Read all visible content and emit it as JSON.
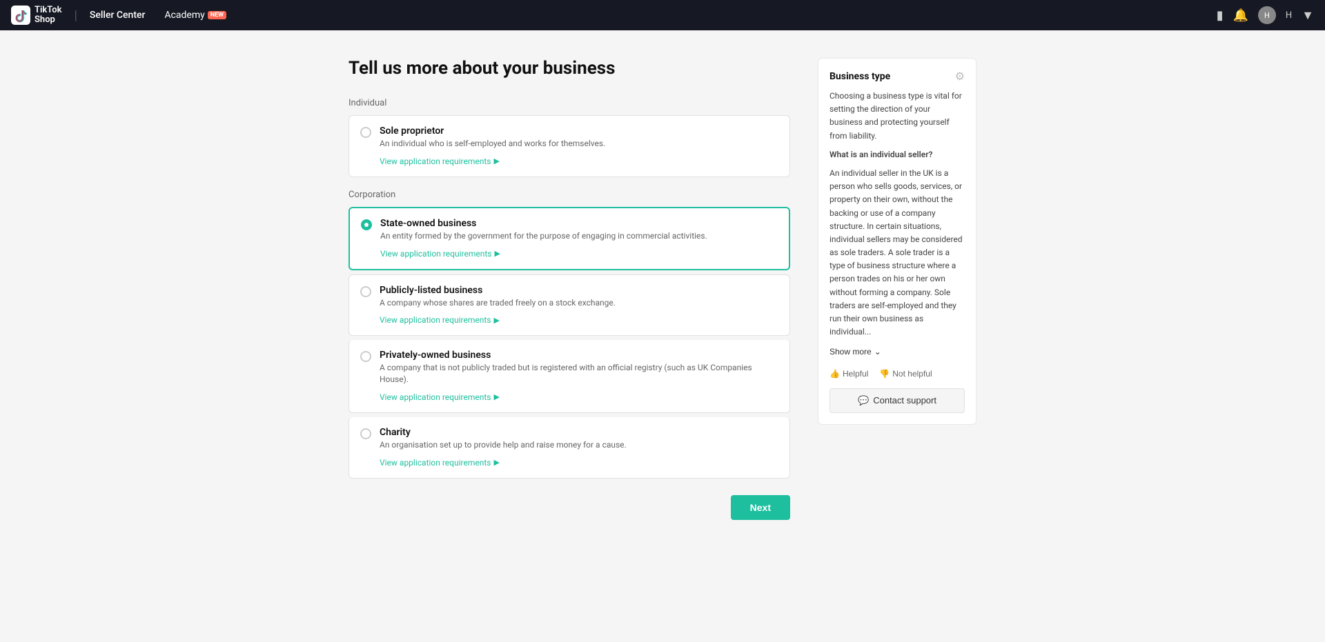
{
  "header": {
    "brand_line1": "TikTok",
    "brand_line2": "Shop",
    "divider": "|",
    "seller_center": "Seller Center",
    "academy": "Academy",
    "badge_new": "NEW",
    "username": "H"
  },
  "page": {
    "title": "Tell us more about your business",
    "individual_label": "Individual",
    "corporation_label": "Corporation"
  },
  "individual_options": [
    {
      "id": "sole-proprietor",
      "title": "Sole proprietor",
      "description": "An individual who is self-employed and works for themselves.",
      "view_req": "View application requirements",
      "selected": false
    }
  ],
  "corporation_options": [
    {
      "id": "state-owned",
      "title": "State-owned business",
      "description": "An entity formed by the government for the purpose of engaging in commercial activities.",
      "view_req": "View application requirements",
      "selected": true
    },
    {
      "id": "publicly-listed",
      "title": "Publicly-listed business",
      "description": "A company whose shares are traded freely on a stock exchange.",
      "view_req": "View application requirements",
      "selected": false
    },
    {
      "id": "privately-owned",
      "title": "Privately-owned business",
      "description": "A company that is not publicly traded but is registered with an official registry (such as UK Companies House).",
      "view_req": "View application requirements",
      "selected": false
    },
    {
      "id": "charity",
      "title": "Charity",
      "description": "An organisation set up to provide help and raise money for a cause.",
      "view_req": "View application requirements",
      "selected": false
    }
  ],
  "next_button": "Next",
  "sidebar": {
    "title": "Business type",
    "intro": "Choosing a business type is vital for setting the direction of your business and protecting yourself from liability.",
    "what_label": "What is an individual seller?",
    "what_body": "An individual seller in the UK is a person who sells goods, services, or property on their own, without the backing or use of a company structure. In certain situations, individual sellers may be considered as sole traders. A sole trader is a type of business structure where a person trades on his or her own without forming a company. Sole traders are self-employed and they run their own business as individual...",
    "show_more": "Show more",
    "helpful": "Helpful",
    "not_helpful": "Not helpful",
    "contact_support": "Contact support"
  }
}
